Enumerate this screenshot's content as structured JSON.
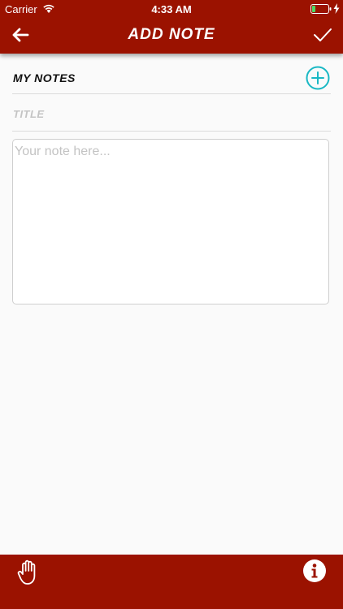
{
  "status_bar": {
    "carrier": "Carrier",
    "time": "4:33 AM",
    "wifi_icon": "wifi-icon",
    "battery_icon": "battery-icon",
    "charging_icon": "bolt-icon"
  },
  "nav": {
    "title": "ADD NOTE",
    "back_icon": "arrow-left-icon",
    "save_icon": "checkmark-icon"
  },
  "notes_section": {
    "label": "MY NOTES",
    "add_icon": "plus-circle-icon"
  },
  "title_field": {
    "placeholder": "TITLE",
    "value": ""
  },
  "note_field": {
    "placeholder": "Your note here...",
    "value": ""
  },
  "bottom_bar": {
    "left_icon": "hand-icon",
    "right_icon": "info-icon"
  },
  "colors": {
    "brand_red": "#9b1200",
    "accent_teal": "#1ab8c4",
    "background": "#fafafa"
  }
}
